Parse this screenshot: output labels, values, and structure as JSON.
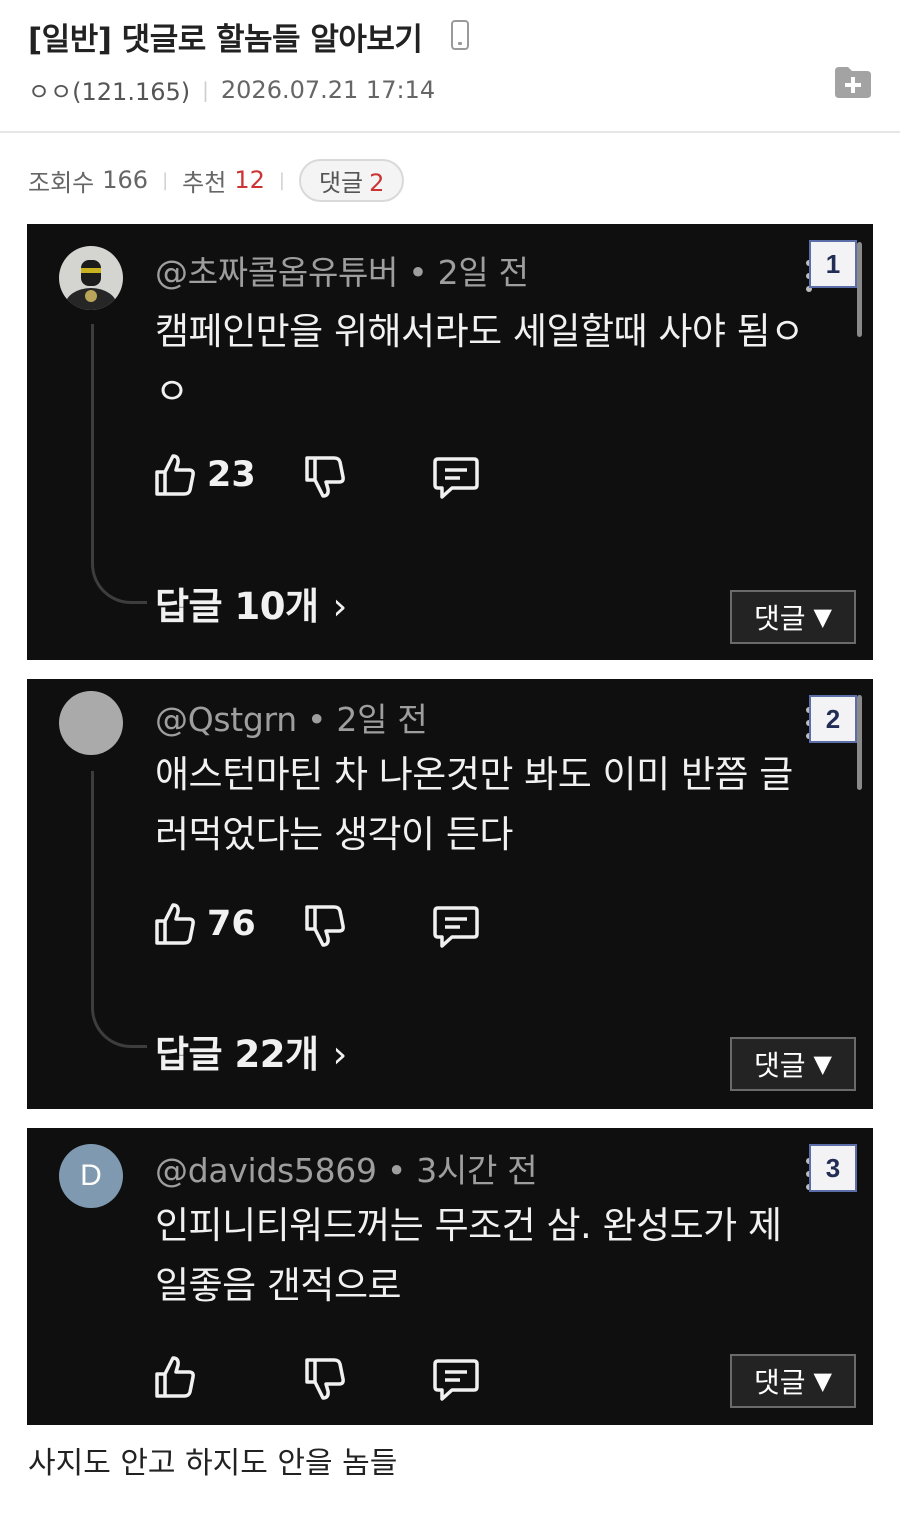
{
  "post": {
    "title": "[일반] 댓글로 할놈들 알아보기",
    "author": "ㅇㅇ(121.165)",
    "date": "2026.07.21 17:14",
    "icons": {
      "device": "mobile-phone-icon",
      "save": "folder-plus-icon"
    }
  },
  "stats": {
    "views_label": "조회수",
    "views": "166",
    "recommend_label": "추천",
    "recommend": "12",
    "comments_label": "댓글",
    "comments": "2"
  },
  "comments": [
    {
      "badge": "1",
      "byline": "@초짜콜옵유튜버 • 2일 전",
      "text": "캠페인만을 위해서라도 세일할때 사야 됨ㅇㅇ",
      "likes": "23",
      "replies": "답글 10개",
      "reply_button": "댓글"
    },
    {
      "badge": "2",
      "byline": "@Qstgrn • 2일 전",
      "text": "애스턴마틴 차 나온것만 봐도 이미 반쯤 글러먹었다는 생각이 든다",
      "likes": "76",
      "replies": "답글 22개",
      "reply_button": "댓글"
    },
    {
      "badge": "3",
      "byline": "@davids5869 • 3시간 전",
      "text": "인피니티워드꺼는 무조건 삼. 완성도가 제일좋음 갠적으로",
      "avatar_letter": "D",
      "reply_button": "댓글"
    }
  ],
  "caption": "사지도 안고 하지도 안을 놈들",
  "colors": {
    "card_bg": "#0f0f0f",
    "recommend_red": "#cc3333",
    "badge_border": "#5b6ea8"
  }
}
